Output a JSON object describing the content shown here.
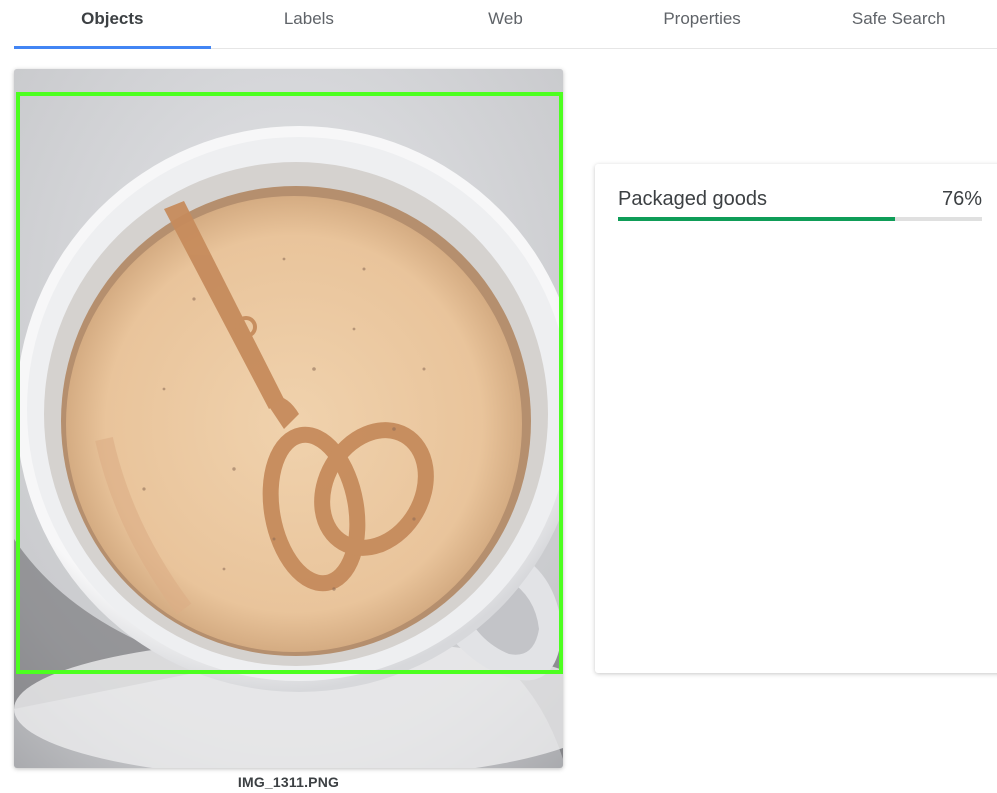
{
  "tabs": [
    {
      "label": "Objects",
      "active": true
    },
    {
      "label": "Labels",
      "active": false
    },
    {
      "label": "Web",
      "active": false
    },
    {
      "label": "Properties",
      "active": false
    },
    {
      "label": "Safe Search",
      "active": false
    }
  ],
  "image": {
    "filename": "IMG_1311.PNG"
  },
  "results": [
    {
      "label": "Packaged goods",
      "score_text": "76%",
      "score": 0.76
    }
  ],
  "colors": {
    "tab_indicator": "#4285f4",
    "bounding_box": "#4cff1f",
    "score_bar": "#0f9d58"
  }
}
